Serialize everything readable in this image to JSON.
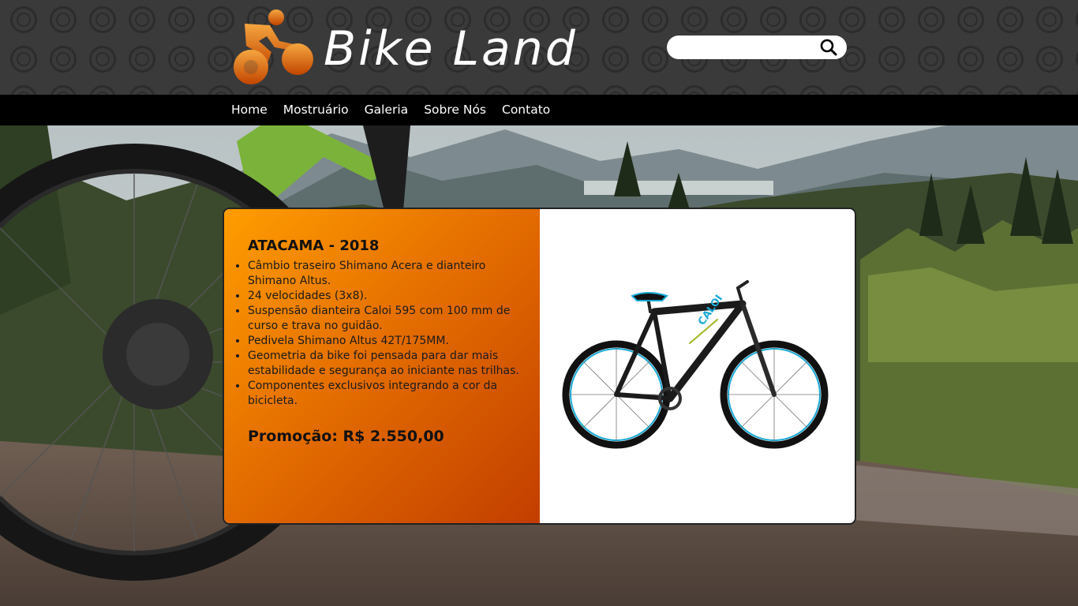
{
  "header": {
    "logo_text": "Bike Land",
    "logo_icon": "cyclist-icon",
    "search": {
      "value": "",
      "placeholder": "",
      "icon": "search-icon"
    }
  },
  "nav": {
    "items": [
      {
        "label": "Home"
      },
      {
        "label": "Mostruário"
      },
      {
        "label": "Galeria"
      },
      {
        "label": "Sobre Nós"
      },
      {
        "label": "Contato"
      }
    ]
  },
  "product": {
    "title": "ATACAMA - 2018",
    "specs": [
      "Câmbio traseiro Shimano Acera e dianteiro Shimano Altus.",
      "24 velocidades (3x8).",
      "Suspensão dianteira Caloi 595 com 100 mm de curso e trava no guidão.",
      "Pedivela Shimano Altus 42T/175MM.",
      "Geometria da bike foi pensada para dar mais estabilidade e segurança ao iniciante nas trilhas.",
      "Componentes exclusivos integrando a cor da bicicleta."
    ],
    "price": "Promoção: R$ 2.550,00",
    "frame_brand": "CALOI"
  },
  "colors": {
    "accent_orange": "#ff9d00",
    "accent_dark_orange": "#c23e00",
    "nav_background": "#000000",
    "bike_accent": "#19a9d4"
  }
}
